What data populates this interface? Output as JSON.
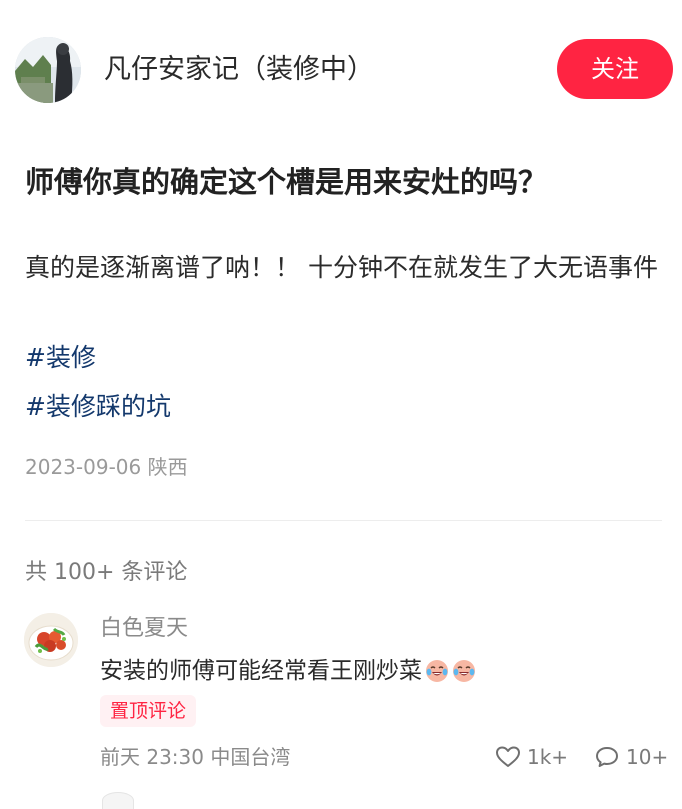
{
  "author": {
    "name": "凡仔安家记（装修中）",
    "avatar_icon": "author-avatar-photo"
  },
  "header": {
    "follow_label": "关注",
    "accent_color": "#ff2442"
  },
  "post": {
    "title": "师傅你真的确定这个槽是用来安灶的吗？",
    "body": "真的是逐渐离谱了呐！！ 十分钟不在就发生了大无语事件",
    "tags": [
      "#装修",
      "#装修踩的坑"
    ],
    "date": "2023-09-06",
    "location": "陕西"
  },
  "comments_section": {
    "count_label": "共 100+ 条评论",
    "items": [
      {
        "user": "白色夏天",
        "text": "安装的师傅可能经常看王刚炒菜",
        "emojis": [
          "crying-laughing-icon",
          "crying-laughing-icon"
        ],
        "badge": "置顶评论",
        "time": "前天 23:30",
        "location": "中国台湾",
        "likes": "1k+",
        "replies": "10+"
      }
    ]
  }
}
